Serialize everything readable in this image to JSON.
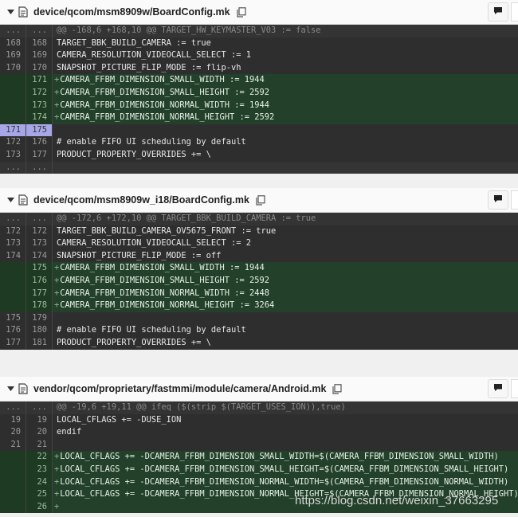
{
  "files": [
    {
      "path": "device/qcom/msm8909w/BoardConfig.mk",
      "lines": [
        {
          "type": "hunk",
          "old": "...",
          "new": "...",
          "text": "@@ -168,6 +168,10 @@ TARGET_HW_KEYMASTER_V03 := false"
        },
        {
          "type": "ctx",
          "old": "168",
          "new": "168",
          "text": "TARGET_BBK_BUILD_CAMERA := true"
        },
        {
          "type": "ctx",
          "old": "169",
          "new": "169",
          "text": "CAMERA_RESOLUTION_VIDEOCALL_SELECT := 1"
        },
        {
          "type": "ctx",
          "old": "170",
          "new": "170",
          "text": "SNAPSHOT_PICTURE_FLIP_MODE := flip-vh"
        },
        {
          "type": "add",
          "old": "",
          "new": "171",
          "text": "CAMERA_FFBM_DIMENSION_SMALL_WIDTH := 1944"
        },
        {
          "type": "add",
          "old": "",
          "new": "172",
          "text": "CAMERA_FFBM_DIMENSION_SMALL_HEIGHT := 2592"
        },
        {
          "type": "add",
          "old": "",
          "new": "173",
          "text": "CAMERA_FFBM_DIMENSION_NORMAL_WIDTH := 1944"
        },
        {
          "type": "add",
          "old": "",
          "new": "174",
          "text": "CAMERA_FFBM_DIMENSION_NORMAL_HEIGHT := 2592"
        },
        {
          "type": "sel",
          "old": "171",
          "new": "175",
          "text": ""
        },
        {
          "type": "ctx",
          "old": "172",
          "new": "176",
          "text": "# enable FIFO UI scheduling by default"
        },
        {
          "type": "ctx",
          "old": "173",
          "new": "177",
          "text": "PRODUCT_PROPERTY_OVERRIDES += \\"
        },
        {
          "type": "expand",
          "old": "...",
          "new": "...",
          "text": ""
        }
      ]
    },
    {
      "path": "device/qcom/msm8909w_i18/BoardConfig.mk",
      "lines": [
        {
          "type": "hunk",
          "old": "...",
          "new": "...",
          "text": "@@ -172,6 +172,10 @@ TARGET_BBK_BUILD_CAMERA := true"
        },
        {
          "type": "ctx",
          "old": "172",
          "new": "172",
          "text": "TARGET_BBK_BUILD_CAMERA_OV5675_FRONT := true"
        },
        {
          "type": "ctx",
          "old": "173",
          "new": "173",
          "text": "CAMERA_RESOLUTION_VIDEOCALL_SELECT := 2"
        },
        {
          "type": "ctx",
          "old": "174",
          "new": "174",
          "text": "SNAPSHOT_PICTURE_FLIP_MODE := off"
        },
        {
          "type": "add",
          "old": "",
          "new": "175",
          "text": "CAMERA_FFBM_DIMENSION_SMALL_WIDTH := 1944"
        },
        {
          "type": "add",
          "old": "",
          "new": "176",
          "text": "CAMERA_FFBM_DIMENSION_SMALL_HEIGHT := 2592"
        },
        {
          "type": "add",
          "old": "",
          "new": "177",
          "text": "CAMERA_FFBM_DIMENSION_NORMAL_WIDTH := 2448"
        },
        {
          "type": "add",
          "old": "",
          "new": "178",
          "text": "CAMERA_FFBM_DIMENSION_NORMAL_HEIGHT := 3264"
        },
        {
          "type": "ctx",
          "old": "175",
          "new": "179",
          "text": ""
        },
        {
          "type": "ctx",
          "old": "176",
          "new": "180",
          "text": "# enable FIFO UI scheduling by default"
        },
        {
          "type": "ctx",
          "old": "177",
          "new": "181",
          "text": "PRODUCT_PROPERTY_OVERRIDES += \\"
        }
      ]
    },
    {
      "path": "vendor/qcom/proprietary/fastmmi/module/camera/Android.mk",
      "lines": [
        {
          "type": "hunk",
          "old": "...",
          "new": "...",
          "text": "@@ -19,6 +19,11 @@ ifeq ($(strip $(TARGET_USES_ION)),true)"
        },
        {
          "type": "ctx",
          "old": "19",
          "new": "19",
          "text": "LOCAL_CFLAGS += -DUSE_ION"
        },
        {
          "type": "ctx",
          "old": "20",
          "new": "20",
          "text": "endif"
        },
        {
          "type": "ctx",
          "old": "21",
          "new": "21",
          "text": ""
        },
        {
          "type": "add",
          "old": "",
          "new": "22",
          "text": "LOCAL_CFLAGS += -DCAMERA_FFBM_DIMENSION_SMALL_WIDTH=$(CAMERA_FFBM_DIMENSION_SMALL_WIDTH)"
        },
        {
          "type": "add",
          "old": "",
          "new": "23",
          "text": "LOCAL_CFLAGS += -DCAMERA_FFBM_DIMENSION_SMALL_HEIGHT=$(CAMERA_FFBM_DIMENSION_SMALL_HEIGHT)"
        },
        {
          "type": "add",
          "old": "",
          "new": "24",
          "text": "LOCAL_CFLAGS += -DCAMERA_FFBM_DIMENSION_NORMAL_WIDTH=$(CAMERA_FFBM_DIMENSION_NORMAL_WIDTH)"
        },
        {
          "type": "add",
          "old": "",
          "new": "25",
          "text": "LOCAL_CFLAGS += -DCAMERA_FFBM_DIMENSION_NORMAL_HEIGHT=$(CAMERA_FFBM_DIMENSION_NORMAL_HEIGHT)"
        },
        {
          "type": "add",
          "old": "",
          "new": "26",
          "text": ""
        }
      ]
    }
  ],
  "watermark": "https://blog.csdn.net/weixin_37663295",
  "icons": {
    "chevron": "chevron-down-icon",
    "file": "file-icon",
    "copy": "copy-icon",
    "comment": "comment-icon"
  },
  "colors": {
    "added_bg": "#23402a",
    "selected_line": "#a7a6e8",
    "code_bg": "#2e2e2e"
  }
}
